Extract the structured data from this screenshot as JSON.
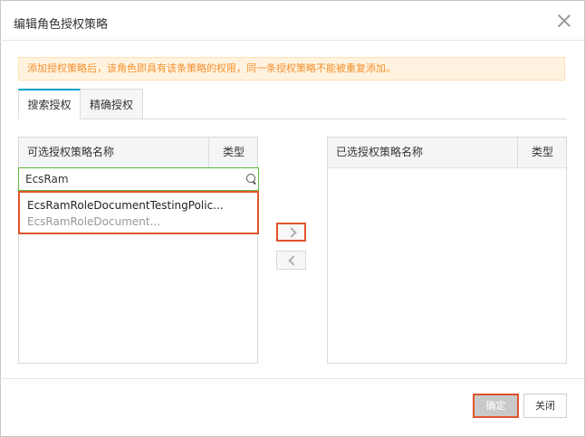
{
  "dialog": {
    "title": "编辑角色授权策略",
    "notice": "添加授权策略后，该角色即具有该条策略的权限，同一条授权策略不能被重复添加。"
  },
  "tabs": [
    {
      "label": "搜索授权",
      "active": true
    },
    {
      "label": "精确授权",
      "active": false
    }
  ],
  "available": {
    "col_name": "可选授权策略名称",
    "col_type": "类型",
    "search_value": "EcsRam",
    "results": [
      {
        "name": "EcsRamRoleDocumentTestingPolic...",
        "description": "EcsRamRoleDocument..."
      }
    ]
  },
  "selected": {
    "col_name": "已选授权策略名称",
    "col_type": "类型"
  },
  "footer": {
    "ok_label": "确定",
    "close_label": "关闭"
  },
  "colors": {
    "warning_text": "#f5902d",
    "warning_bg": "#fff3e0",
    "highlight": "#e0542e",
    "tab_accent": "#00a2ca",
    "search_border": "#5fb93c"
  }
}
